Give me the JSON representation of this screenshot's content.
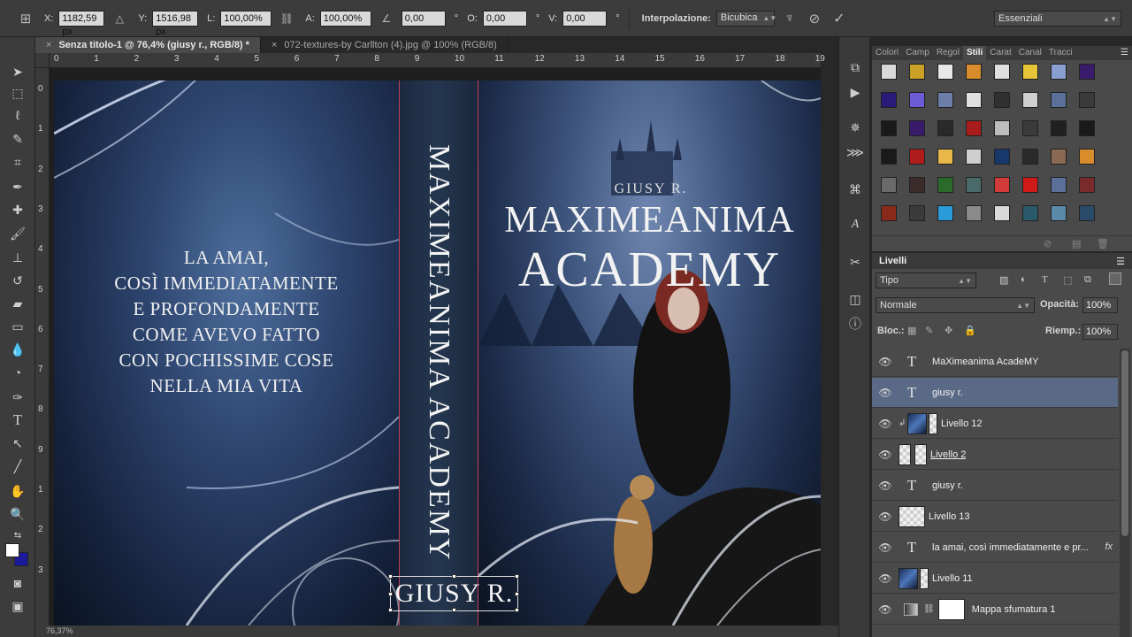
{
  "options": {
    "x_label": "X:",
    "x_value": "1182,59 px",
    "y_label": "Y:",
    "y_value": "1516,98 px",
    "w_label": "L:",
    "w_value": "100,00%",
    "h_label": "A:",
    "h_value": "100,00%",
    "angle_value": "0,00",
    "deg": "°",
    "o_label": "O:",
    "o_value": "0,00",
    "v_label": "V:",
    "v_value": "0,00",
    "interp_label": "Interpolazione:",
    "interp_value": "Bicubica",
    "workspace": "Essenziali"
  },
  "tabs": [
    {
      "label": "Senza titolo-1 @ 76,4% (giusy r., RGB/8) *",
      "close": "×"
    },
    {
      "label": "072-textures-by Carllton (4).jpg @ 100% (RGB/8)",
      "close": "×"
    }
  ],
  "ruler_h": [
    "0",
    "1",
    "2",
    "3",
    "4",
    "5",
    "6",
    "7",
    "8",
    "9",
    "10",
    "11",
    "12",
    "13",
    "14",
    "15",
    "16",
    "17",
    "18",
    "19"
  ],
  "ruler_v": [
    "0",
    "1",
    "2",
    "3",
    "4",
    "5",
    "6",
    "7",
    "8",
    "9",
    "1",
    "2",
    "3"
  ],
  "artwork": {
    "back_lines": [
      "LA AMAI,",
      "COSÌ IMMEDIATAMENTE",
      "E PROFONDAMENTE",
      "COME AVEVO FATTO",
      "CON POCHISSIME COSE",
      "NELLA MIA VITA"
    ],
    "spine_title": "MAXIMEANIMA ACADEMY",
    "author_top": "GIUSY R.",
    "front_title_1": "MAXIMEANIMA",
    "front_title_2": "ACADEMY",
    "spine_author": "GIUSY R."
  },
  "status": "76,37%",
  "styles_tabs": [
    "Colori",
    "Camp",
    "Regol",
    "Stili",
    "Carat",
    "Canal",
    "Tracci"
  ],
  "styles_swatches": [
    "#d9d9d9",
    "#c9a227",
    "#e8e8e8",
    "#d98c2c",
    "#e0e0e0",
    "#e6c638",
    "#8a9fd1",
    "#3a1a6a",
    "#2a1a7a",
    "#6b5bd6",
    "#6c7ea8",
    "#e0e0e0",
    "#303030",
    "#cfcfcf",
    "#5a6f9a",
    "#3a3a3a",
    "#1a1a1a",
    "#3a1a6a",
    "#2a2a2a",
    "#a81c1c",
    "#bdbdbd",
    "#3a3a3a",
    "#202020",
    "#1a1a1a",
    "#1a1a1a",
    "#b01c1c",
    "#e8b84a",
    "#cfcfcf",
    "#17386a",
    "#2a2a2a",
    "#8b6a55",
    "#d98c2c",
    "#6a6a6a",
    "#3a2a2a",
    "#2a6a2a",
    "#4a6a6a",
    "#d33a3a",
    "#d01a1a",
    "#5a6f9a",
    "#7a2a2a",
    "#8a2a1a",
    "#3a3a3a",
    "#2a9ad8",
    "#8a8a8a",
    "#d9d9d9",
    "#2a5a6a",
    "#5a8aa8",
    "#2a4a6a"
  ],
  "layers": {
    "title": "Livelli",
    "filter": "Tipo",
    "blend": "Normale",
    "opacity_label": "Opacità:",
    "opacity": "100%",
    "lock_label": "Bloc.:",
    "fill_label": "Riemp.:",
    "fill": "100%",
    "items": [
      {
        "name": "MaXimeanima AcadeMY",
        "kind": "text"
      },
      {
        "name": "giusy r.",
        "kind": "text"
      },
      {
        "name": "Livello 12",
        "kind": "image"
      },
      {
        "name": "Livello 2",
        "kind": "pixel"
      },
      {
        "name": "giusy r.",
        "kind": "text"
      },
      {
        "name": "Livello 13",
        "kind": "pixel"
      },
      {
        "name": "la amai, così immediatamente e pr...",
        "kind": "text",
        "fx": "fx"
      },
      {
        "name": "Livello 11",
        "kind": "image"
      },
      {
        "name": "Mappa sfumatura 1",
        "kind": "adjust"
      }
    ]
  }
}
